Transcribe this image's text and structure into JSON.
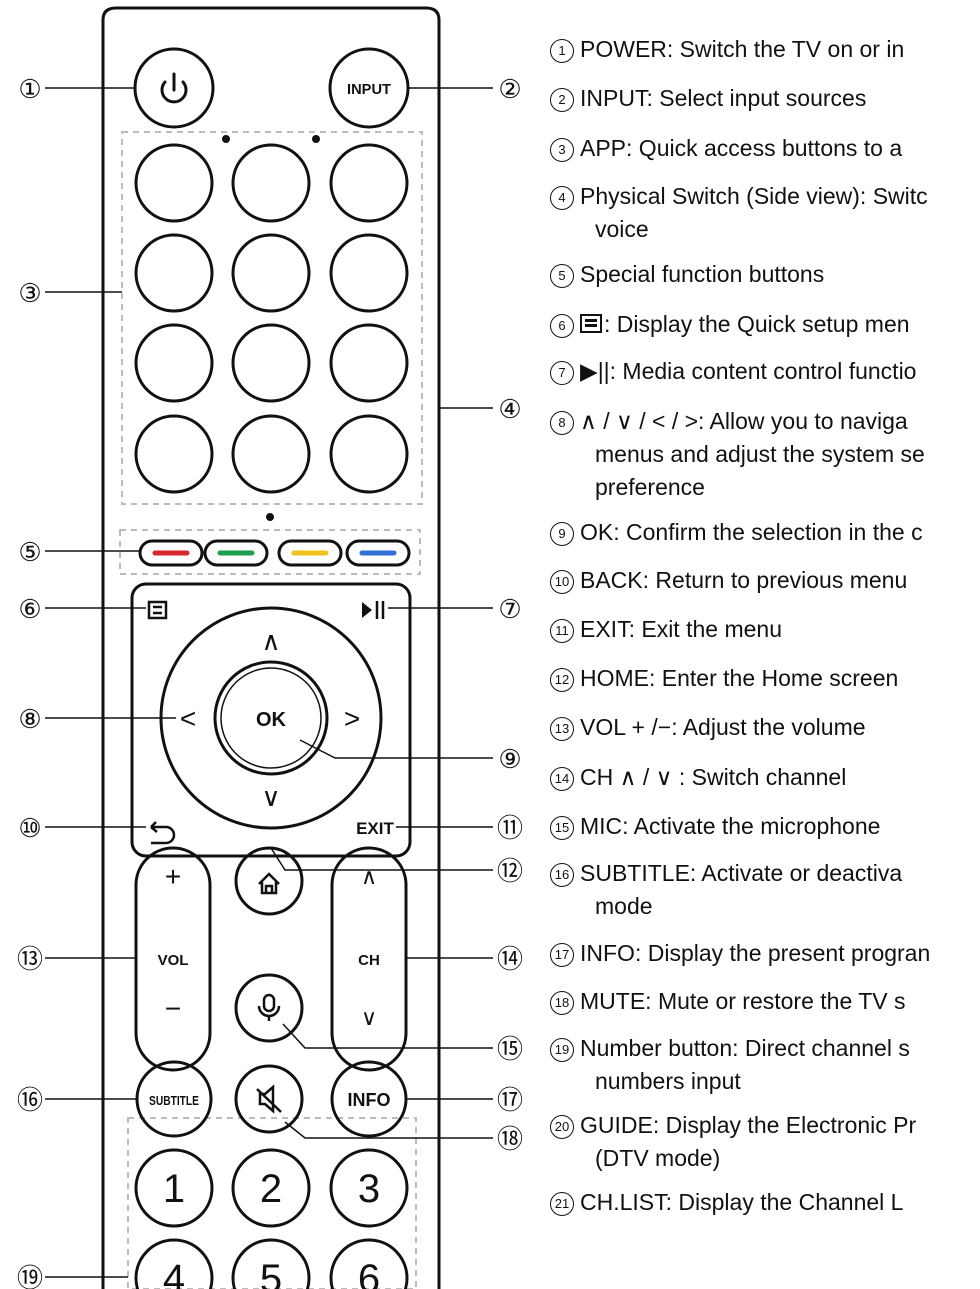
{
  "remote": {
    "power_icon": "power-icon",
    "input_label": "INPUT",
    "color_keys": [
      "#d7262f",
      "#1b9f4b",
      "#f1c21b",
      "#2f6fd6"
    ],
    "menu_icon": "menu-icon",
    "play_pause_icon": "play-pause-icon",
    "nav_up": "∧",
    "nav_down": "∨",
    "nav_left": "<",
    "nav_right": ">",
    "ok_label": "OK",
    "back_icon": "back-arrow-icon",
    "exit_label": "EXIT",
    "vol_plus": "+",
    "vol_label": "VOL",
    "vol_minus": "−",
    "home_icon": "home-icon",
    "mic_icon": "microphone-icon",
    "ch_up": "∧",
    "ch_label": "CH",
    "ch_down": "∨",
    "subtitle_label": "SUBTITLE",
    "mute_icon": "mute-icon",
    "info_label": "INFO",
    "numbers": [
      "1",
      "2",
      "3",
      "4",
      "5",
      "6"
    ]
  },
  "callouts": [
    "①",
    "②",
    "③",
    "④",
    "⑤",
    "⑥",
    "⑦",
    "⑧",
    "⑨",
    "⑩",
    "⑪",
    "⑫",
    "⑬",
    "⑭",
    "⑮",
    "⑯",
    "⑰",
    "⑱",
    "⑲"
  ],
  "legend": [
    {
      "num": "1",
      "text": "POWER: Switch the TV on or in"
    },
    {
      "num": "2",
      "text": "INPUT: Select input sources"
    },
    {
      "num": "3",
      "text": "APP: Quick access buttons to a"
    },
    {
      "num": "4",
      "text": "Physical Switch (Side view): Switc",
      "cont": "voice"
    },
    {
      "num": "5",
      "text": "Special function buttons"
    },
    {
      "num": "6",
      "text": ": Display the Quick setup men",
      "icon": "menu"
    },
    {
      "num": "7",
      "text": "▶||: Media content control functio"
    },
    {
      "num": "8",
      "text": "∧ / ∨ / < / >: Allow you to naviga",
      "cont": "menus and adjust the system se",
      "cont2": "preference"
    },
    {
      "num": "9",
      "text": "OK: Confirm the selection in the c"
    },
    {
      "num": "10",
      "text": "BACK: Return to previous menu"
    },
    {
      "num": "11",
      "text": "EXIT: Exit the menu"
    },
    {
      "num": "12",
      "text": "HOME: Enter the Home screen"
    },
    {
      "num": "13",
      "text": "VOL + /−: Adjust the volume"
    },
    {
      "num": "14",
      "text": "CH ∧ / ∨ : Switch channel"
    },
    {
      "num": "15",
      "text": "MIC: Activate the microphone"
    },
    {
      "num": "16",
      "text": "SUBTITLE: Activate or deactiva",
      "cont": "mode"
    },
    {
      "num": "17",
      "text": "INFO: Display the present progran"
    },
    {
      "num": "18",
      "text": "MUTE: Mute or restore the TV s"
    },
    {
      "num": "19",
      "text": "Number button: Direct channel s",
      "cont": "numbers input"
    },
    {
      "num": "20",
      "text": "GUIDE: Display the Electronic Pr",
      "cont": "(DTV mode)"
    },
    {
      "num": "21",
      "text": "CH.LIST: Display the Channel L"
    }
  ]
}
